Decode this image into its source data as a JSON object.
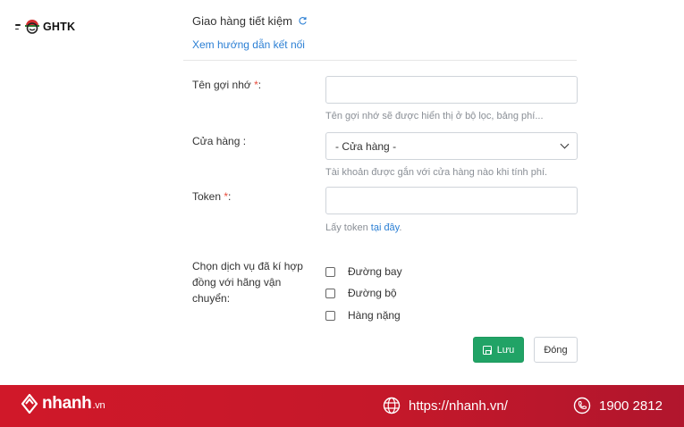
{
  "brand": {
    "logo_text": "GHTK"
  },
  "header": {
    "title": "Giao hàng tiết kiệm",
    "guide_link": "Xem hướng dẫn kết nối"
  },
  "form": {
    "nickname": {
      "label": "Tên gợi nhớ",
      "required_mark": "*",
      "colon": ":",
      "value": "",
      "hint": "Tên gợi nhớ sẽ được hiển thị ở bộ lọc, bảng phí..."
    },
    "store": {
      "label": "Cửa hàng :",
      "selected": "- Cửa hàng -",
      "hint": "Tài khoản được gắn với cửa hàng nào khi tính phí."
    },
    "token": {
      "label": "Token",
      "required_mark": "*",
      "colon": ":",
      "value": "",
      "hint_prefix": "Lấy token ",
      "hint_link": "tại đây",
      "hint_suffix": "."
    },
    "services": {
      "label": "Chọn dịch vụ đã kí hợp đồng với hãng vận chuyển:",
      "options": [
        {
          "label": "Đường bay",
          "checked": false
        },
        {
          "label": "Đường bộ",
          "checked": false
        },
        {
          "label": "Hàng nặng",
          "checked": false
        }
      ]
    },
    "save_label": "Lưu",
    "close_label": "Đóng"
  },
  "footer": {
    "brand_name": "nhanh",
    "brand_tld": ".vn",
    "website": "https://nhanh.vn/",
    "phone": "1900 2812"
  },
  "colors": {
    "accent": "#2b7fd4",
    "save_button": "#21a366",
    "required": "#e74c3c",
    "footer": "#c8182b"
  }
}
